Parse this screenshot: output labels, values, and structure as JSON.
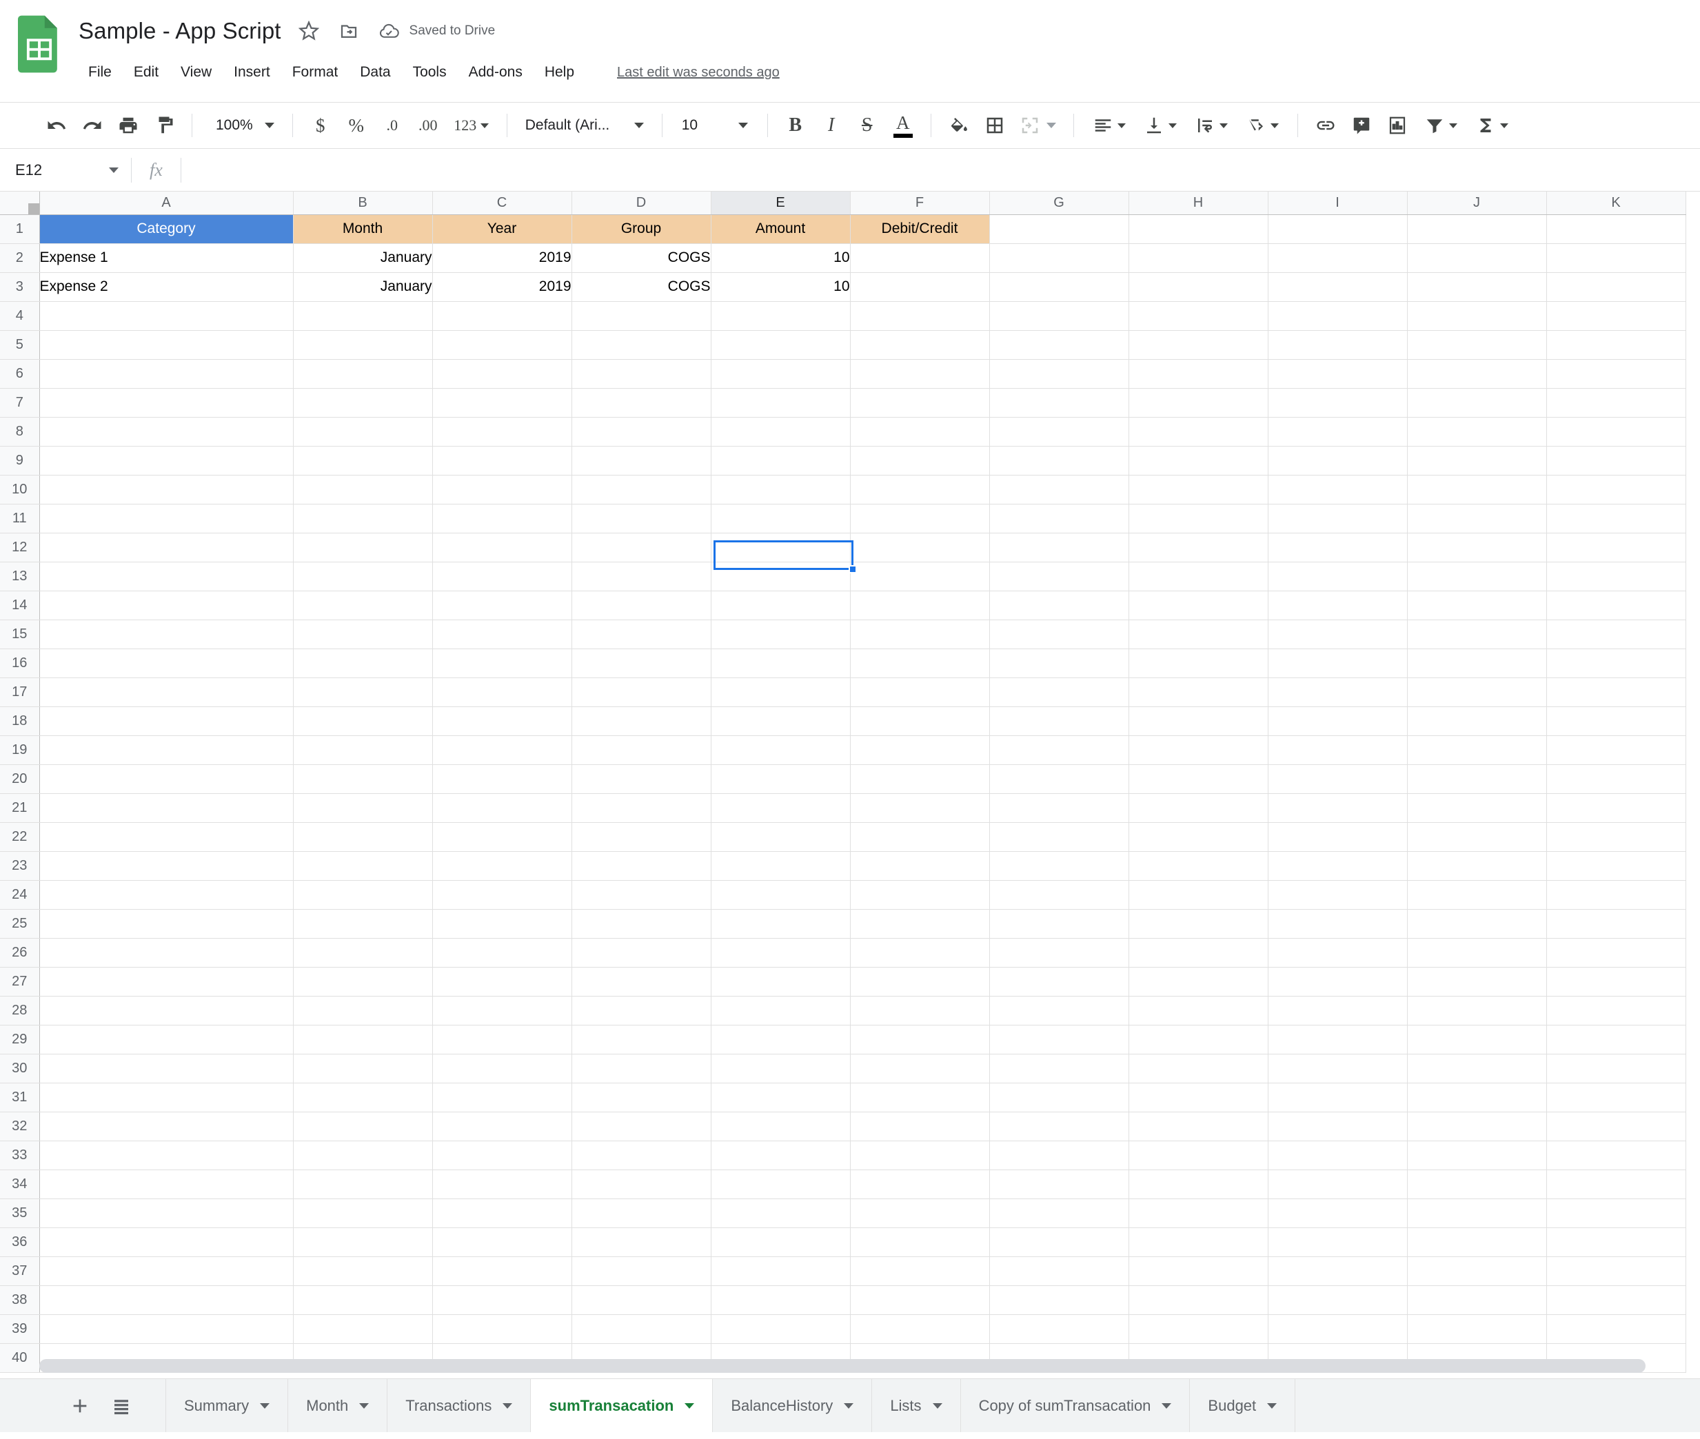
{
  "app": {
    "logo_icon": "sheets-logo-icon",
    "doc_title": "Sample - App Script",
    "star_icon": "star-icon",
    "move_folder_icon": "move-to-folder-icon",
    "cloud_icon": "cloud-saved-icon",
    "saved_status": "Saved to Drive",
    "last_edit": "Last edit was seconds ago"
  },
  "menu": {
    "items": [
      {
        "label": "File"
      },
      {
        "label": "Edit"
      },
      {
        "label": "View"
      },
      {
        "label": "Insert"
      },
      {
        "label": "Format"
      },
      {
        "label": "Data"
      },
      {
        "label": "Tools"
      },
      {
        "label": "Add-ons"
      },
      {
        "label": "Help"
      }
    ]
  },
  "toolbar": {
    "undo_icon": "undo-icon",
    "redo_icon": "redo-icon",
    "print_icon": "print-icon",
    "paint_format_icon": "paint-format-icon",
    "zoom_value": "100%",
    "currency_label": "$",
    "percent_label": "%",
    "decrease_decimal_label": ".0",
    "increase_decimal_label": ".00",
    "more_formats_label": "123",
    "font_name": "Default (Ari...",
    "font_size": "10",
    "bold_label": "B",
    "italic_label": "I",
    "strikethrough_label": "S",
    "text_color_label": "A",
    "fill_color_icon": "fill-color-icon",
    "borders_icon": "borders-icon",
    "merge_cells_icon": "merge-cells-icon",
    "horizontal_align_icon": "horizontal-align-icon",
    "vertical_align_icon": "vertical-align-icon",
    "text_wrap_icon": "text-wrap-icon",
    "text_rotation_icon": "text-rotation-icon",
    "insert_link_icon": "insert-link-icon",
    "insert_comment_icon": "insert-comment-icon",
    "insert_chart_icon": "insert-chart-icon",
    "filter_icon": "filter-icon",
    "functions_icon": "functions-sigma-icon"
  },
  "formula_bar": {
    "name_box_value": "E12",
    "fx_label": "fx",
    "formula_value": ""
  },
  "grid": {
    "columns": [
      "A",
      "B",
      "C",
      "D",
      "E",
      "F",
      "G",
      "H",
      "I",
      "J",
      "K"
    ],
    "selected_column": "E",
    "selected_cell": "E12",
    "row_count": 40,
    "header_row": {
      "A": "Category",
      "B": "Month",
      "C": "Year",
      "D": "Group",
      "E": "Amount",
      "F": "Debit/Credit"
    },
    "header_colors": {
      "category_bg": "#4a86d9",
      "category_fg": "#ffffff",
      "other_bg": "#f3cfa4",
      "other_fg": "#000000"
    },
    "selection_color": "#1a73e8",
    "rows": [
      {
        "row": 2,
        "A": "Expense 1",
        "B": "January",
        "C": "2019",
        "D": "COGS",
        "E": "10",
        "F": ""
      },
      {
        "row": 3,
        "A": "Expense 2",
        "B": "January",
        "C": "2019",
        "D": "COGS",
        "E": "10",
        "F": ""
      }
    ]
  },
  "sheet_tabs": {
    "add_sheet_icon": "add-sheet-plus-icon",
    "all_sheets_icon": "all-sheets-list-icon",
    "active_color": "#188038",
    "tabs": [
      {
        "label": "Summary",
        "active": false
      },
      {
        "label": "Month",
        "active": false
      },
      {
        "label": "Transactions",
        "active": false
      },
      {
        "label": "sumTransacation",
        "active": true
      },
      {
        "label": "BalanceHistory",
        "active": false
      },
      {
        "label": "Lists",
        "active": false
      },
      {
        "label": "Copy of sumTransacation",
        "active": false
      },
      {
        "label": "Budget",
        "active": false
      }
    ]
  }
}
